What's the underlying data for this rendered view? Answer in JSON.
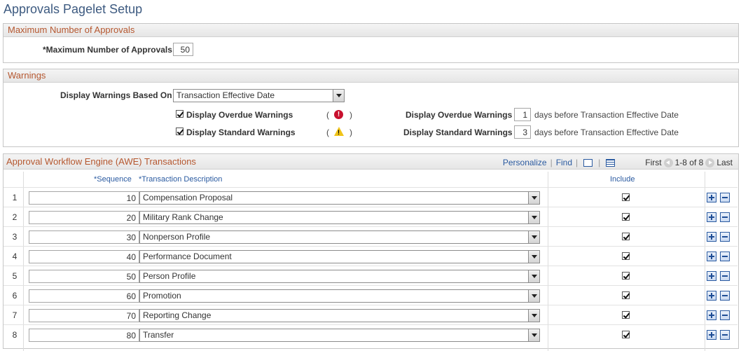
{
  "page": {
    "title": "Approvals Pagelet Setup"
  },
  "max_approvals": {
    "header": "Maximum Number of Approvals",
    "label": "*Maximum Number of Approvals",
    "value": "50"
  },
  "warnings": {
    "header": "Warnings",
    "based_on_label": "Display Warnings Based On",
    "based_on_value": "Transaction Effective Date",
    "overdue": {
      "checkbox_label": "Display Overdue Warnings",
      "icon": "error-icon",
      "days_label": "Display Overdue Warnings",
      "days_value": "1",
      "days_suffix": "days before Transaction Effective Date",
      "checked": true
    },
    "standard": {
      "checkbox_label": "Display Standard Warnings",
      "icon": "warning-icon",
      "days_label": "Display Standard Warnings",
      "days_value": "3",
      "days_suffix": "days before Transaction Effective Date",
      "checked": true
    },
    "paren_open": "(",
    "paren_close": ")"
  },
  "awe": {
    "header": "Approval Workflow Engine (AWE) Transactions",
    "nav": {
      "personalize": "Personalize",
      "separator": "|",
      "find": "Find",
      "first": "First",
      "range": "1-8 of 8",
      "last": "Last"
    },
    "columns": {
      "sequence": "*Sequence",
      "description": "*Transaction Description",
      "include": "Include"
    },
    "rows": [
      {
        "num": "1",
        "sequence": "10",
        "description": "Compensation Proposal",
        "include": true
      },
      {
        "num": "2",
        "sequence": "20",
        "description": "Military Rank Change",
        "include": true
      },
      {
        "num": "3",
        "sequence": "30",
        "description": "Nonperson Profile",
        "include": true
      },
      {
        "num": "4",
        "sequence": "40",
        "description": "Performance Document",
        "include": true
      },
      {
        "num": "5",
        "sequence": "50",
        "description": "Person Profile",
        "include": true
      },
      {
        "num": "6",
        "sequence": "60",
        "description": "Promotion",
        "include": true
      },
      {
        "num": "7",
        "sequence": "70",
        "description": "Reporting Change",
        "include": true
      },
      {
        "num": "8",
        "sequence": "80",
        "description": "Transfer",
        "include": true
      }
    ]
  },
  "colors": {
    "title": "#3d5a80",
    "section_header": "#b5572f",
    "link": "#2a5aa0"
  }
}
